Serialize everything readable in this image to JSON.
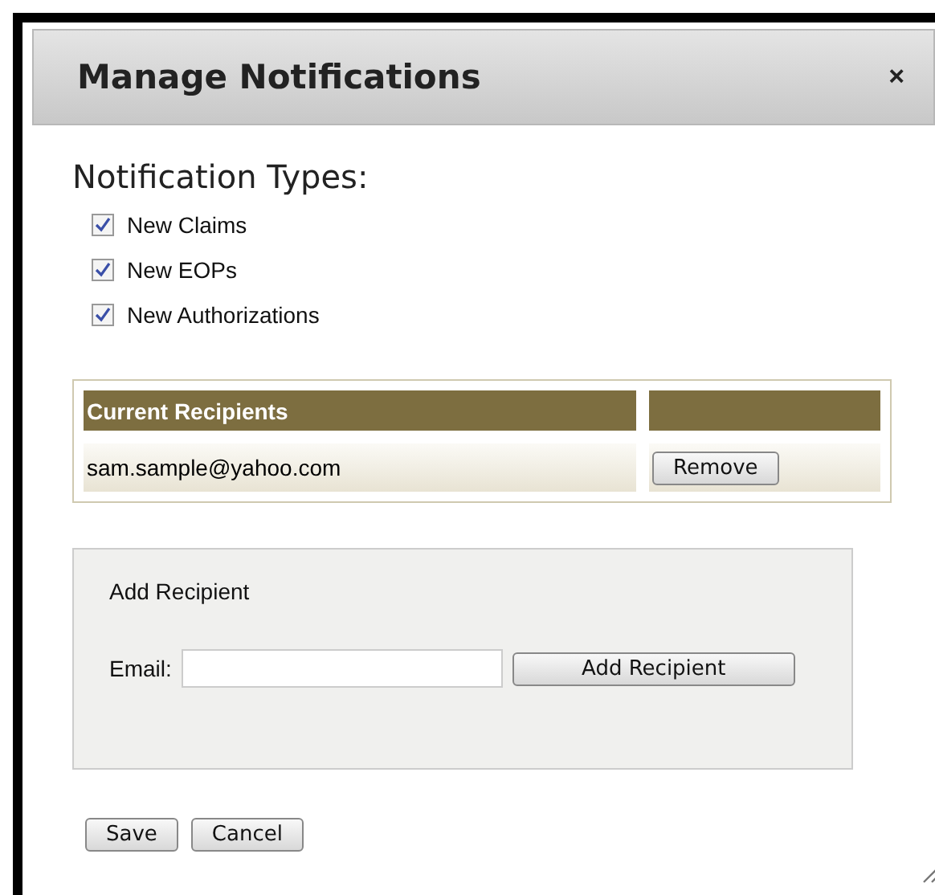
{
  "dialog": {
    "title": "Manage Notifications",
    "close": "×"
  },
  "notification_types": {
    "heading": "Notification Types:",
    "options": [
      {
        "label": "New Claims",
        "checked": true
      },
      {
        "label": "New EOPs",
        "checked": true
      },
      {
        "label": "New Authorizations",
        "checked": true
      }
    ]
  },
  "recipients": {
    "columns": [
      "Current Recipients"
    ],
    "rows": [
      {
        "email": "sam.sample@yahoo.com",
        "action": "Remove"
      }
    ]
  },
  "add_recipient": {
    "title": "Add Recipient",
    "label": "Email:",
    "button": "Add Recipient"
  },
  "buttons": [
    "Save",
    "Cancel"
  ]
}
